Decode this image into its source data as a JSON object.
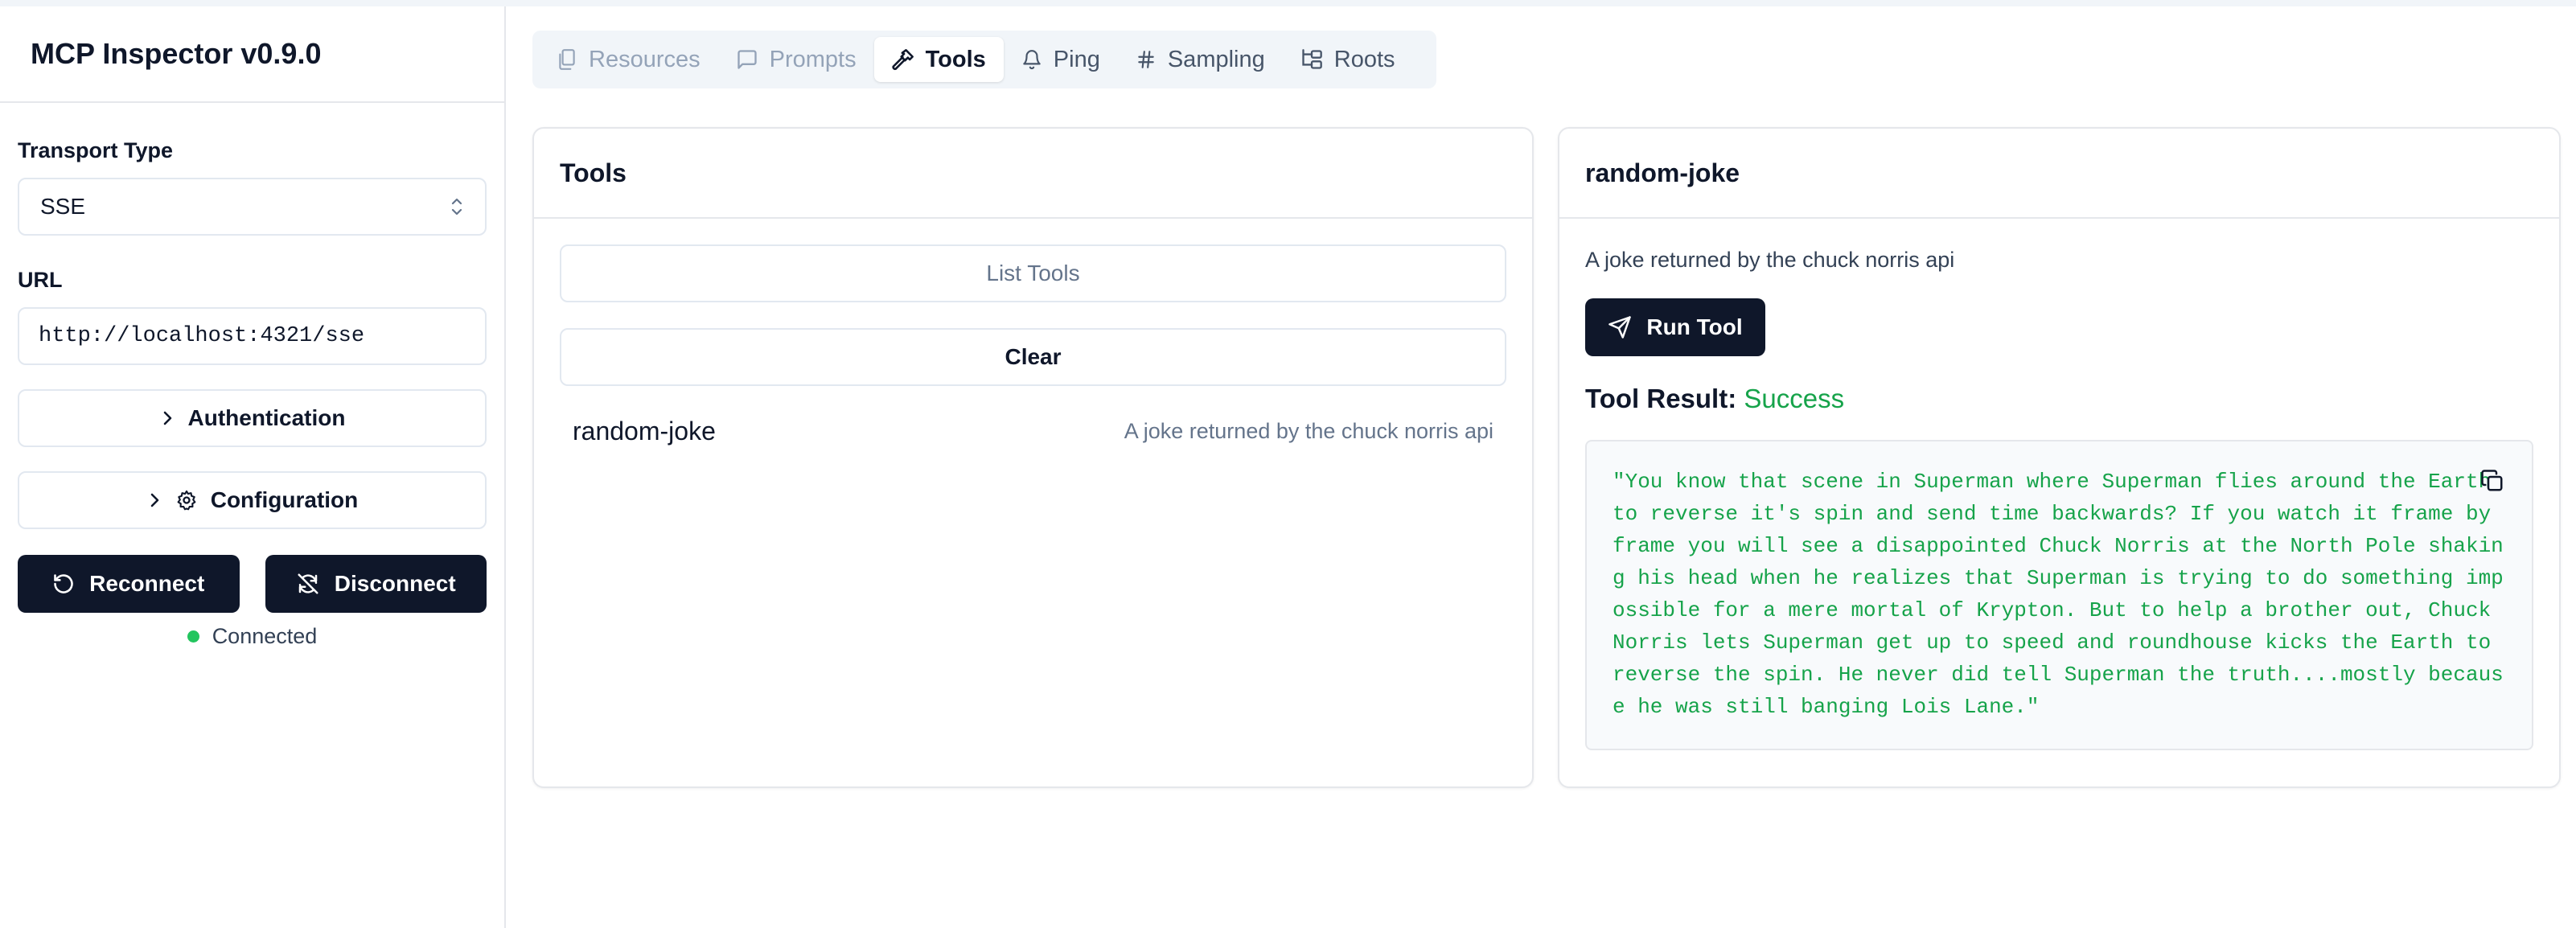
{
  "app": {
    "title": "MCP Inspector v0.9.0"
  },
  "sidebar": {
    "transport_label": "Transport Type",
    "transport_value": "SSE",
    "url_label": "URL",
    "url_value": "http://localhost:4321/sse",
    "authentication_label": "Authentication",
    "configuration_label": "Configuration",
    "reconnect_label": "Reconnect",
    "disconnect_label": "Disconnect",
    "status_text": "Connected",
    "status_color": "#22c55e"
  },
  "tabs": [
    {
      "label": "Resources",
      "icon": "files-icon",
      "state": "disabled"
    },
    {
      "label": "Prompts",
      "icon": "message-square-icon",
      "state": "disabled"
    },
    {
      "label": "Tools",
      "icon": "hammer-icon",
      "state": "active"
    },
    {
      "label": "Ping",
      "icon": "bell-icon",
      "state": "normal"
    },
    {
      "label": "Sampling",
      "icon": "hash-icon",
      "state": "normal"
    },
    {
      "label": "Roots",
      "icon": "folder-tree-icon",
      "state": "normal"
    }
  ],
  "tools_panel": {
    "title": "Tools",
    "list_button": "List Tools",
    "clear_button": "Clear",
    "items": [
      {
        "name": "random-joke",
        "description": "A joke returned by the chuck norris api"
      }
    ]
  },
  "detail_panel": {
    "title": "random-joke",
    "description": "A joke returned by the chuck norris api",
    "run_button": "Run Tool",
    "result_label": "Tool Result:",
    "result_status": "Success",
    "result_status_color": "#16a34a",
    "result_text": "\"You know that scene in Superman where Superman flies around the Earth to reverse it's spin and send time backwards? If you watch it frame by frame you will see a disappointed Chuck Norris at the North Pole shaking his head when he realizes that Superman is trying to do something impossible for a mere mortal of Krypton. But to help a brother out, Chuck Norris lets Superman get up to speed and roundhouse kicks the Earth to reverse the spin. He never did tell Superman the truth....mostly because he was still banging Lois Lane.\""
  }
}
